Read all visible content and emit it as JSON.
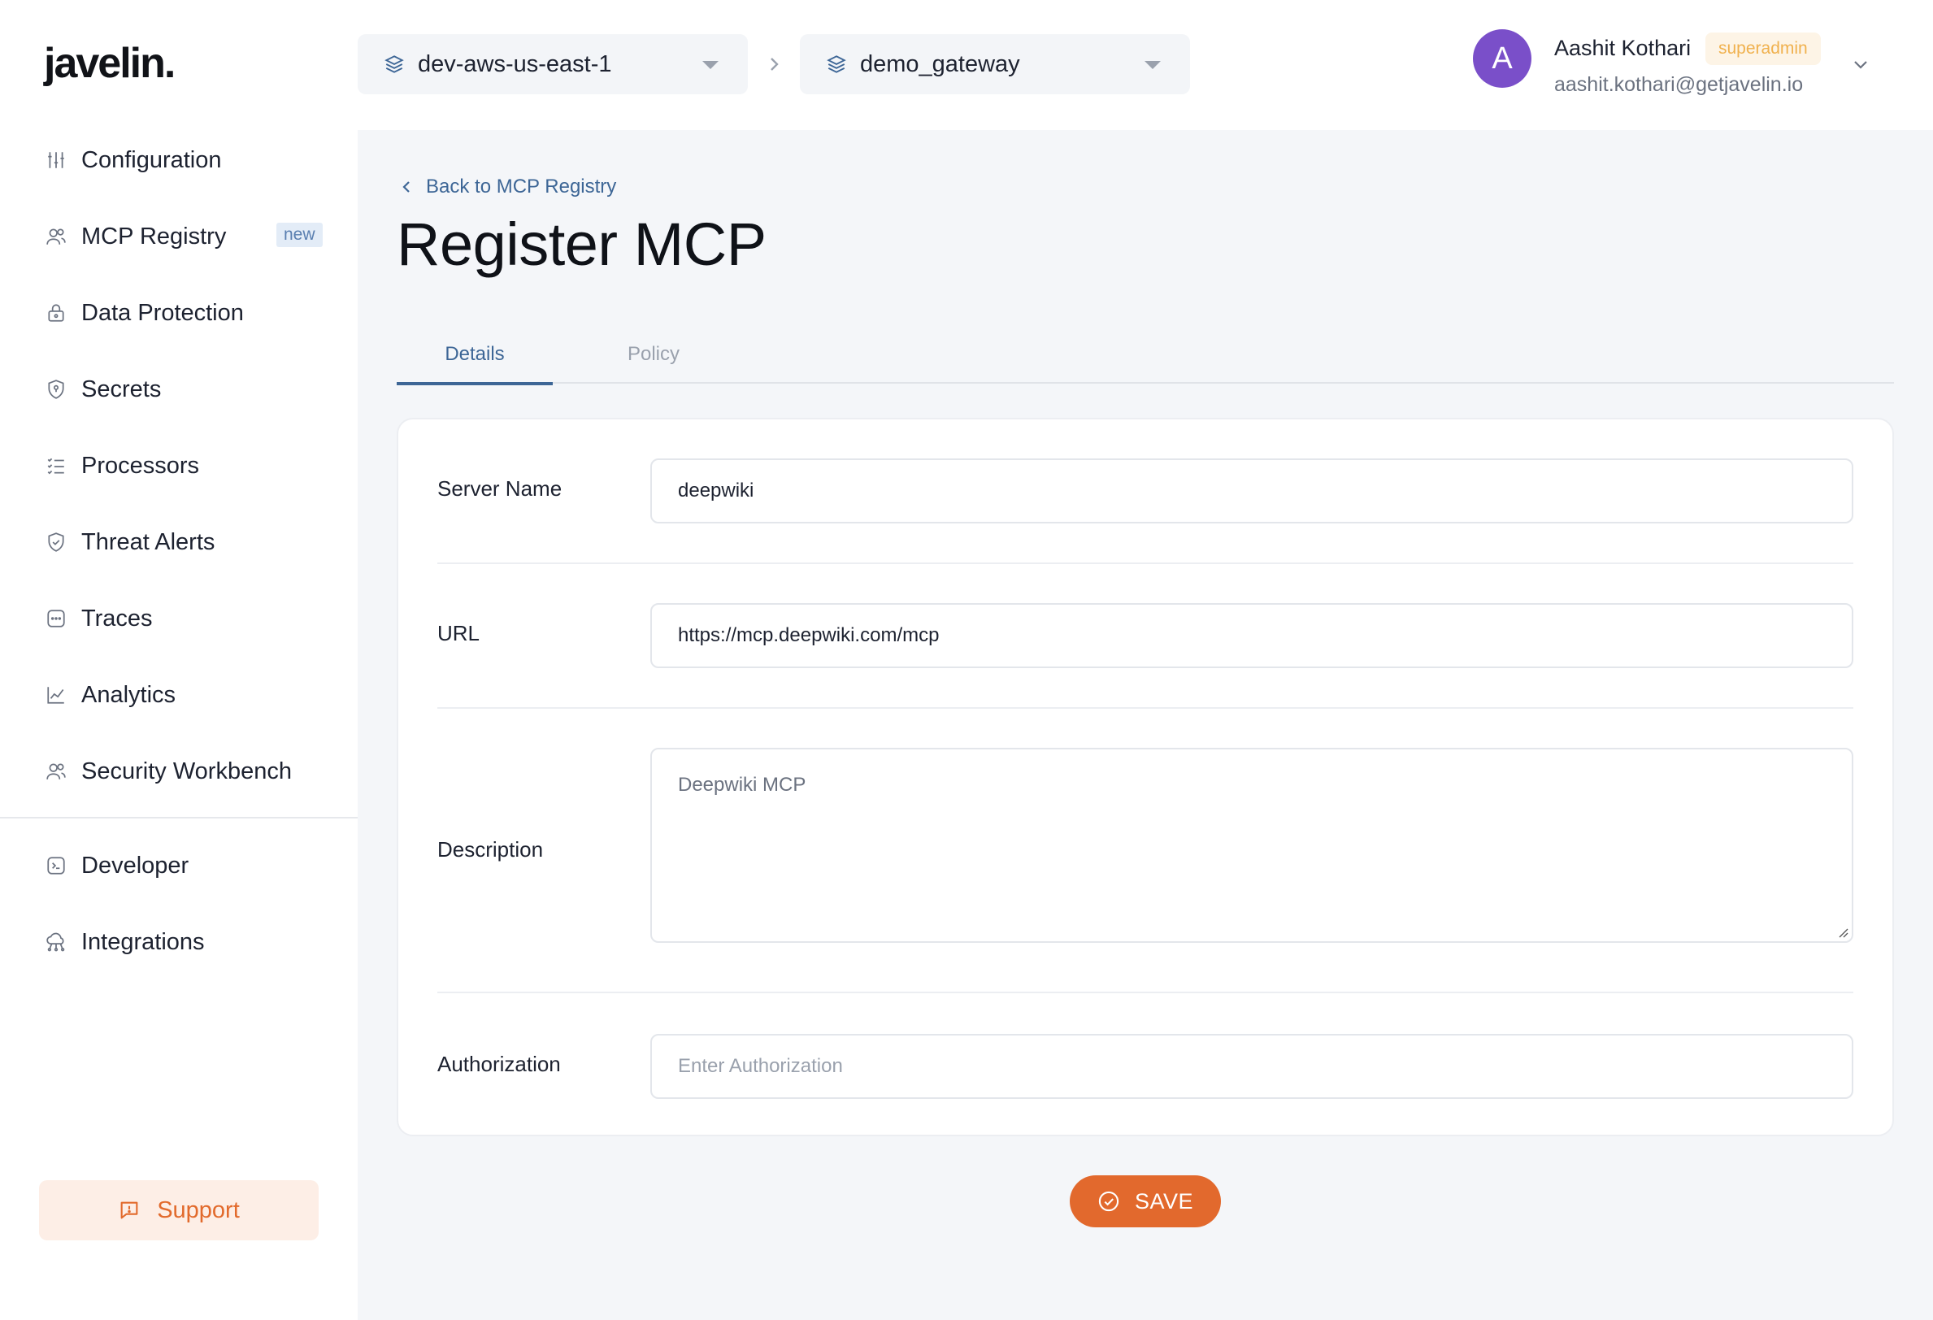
{
  "brand": {
    "logo_text": "javelin."
  },
  "sidebar": {
    "items": [
      {
        "label": "Configuration",
        "icon": "sliders-icon"
      },
      {
        "label": "MCP Registry",
        "icon": "users-icon",
        "badge": "new"
      },
      {
        "label": "Data Protection",
        "icon": "lock-icon"
      },
      {
        "label": "Secrets",
        "icon": "shield-key-icon"
      },
      {
        "label": "Processors",
        "icon": "checklist-icon"
      },
      {
        "label": "Threat Alerts",
        "icon": "shield-check-icon"
      },
      {
        "label": "Traces",
        "icon": "dots-square-icon"
      },
      {
        "label": "Analytics",
        "icon": "chart-line-icon"
      },
      {
        "label": "Security Workbench",
        "icon": "users-icon"
      }
    ],
    "secondary_items": [
      {
        "label": "Developer",
        "icon": "terminal-icon"
      },
      {
        "label": "Integrations",
        "icon": "cloud-network-icon"
      }
    ],
    "support_label": "Support"
  },
  "header": {
    "environment": "dev-aws-us-east-1",
    "gateway": "demo_gateway",
    "user": {
      "initial": "A",
      "name": "Aashit Kothari",
      "role": "superadmin",
      "email": "aashit.kothari@getjavelin.io"
    }
  },
  "main": {
    "back_link": "Back to MCP Registry",
    "title": "Register MCP",
    "tabs": [
      {
        "label": "Details",
        "active": true
      },
      {
        "label": "Policy",
        "active": false
      }
    ],
    "form": {
      "server_name_label": "Server Name",
      "server_name_value": "deepwiki",
      "url_label": "URL",
      "url_value": "https://mcp.deepwiki.com/mcp",
      "description_label": "Description",
      "description_value": "Deepwiki MCP",
      "authorization_label": "Authorization",
      "authorization_placeholder": "Enter Authorization"
    },
    "save_label": "SAVE"
  },
  "colors": {
    "accent": "#3d6696",
    "save": "#e2692d",
    "avatar": "#7a4fc9",
    "role_badge_text": "#f0b14e",
    "main_bg": "#f4f6f9"
  }
}
